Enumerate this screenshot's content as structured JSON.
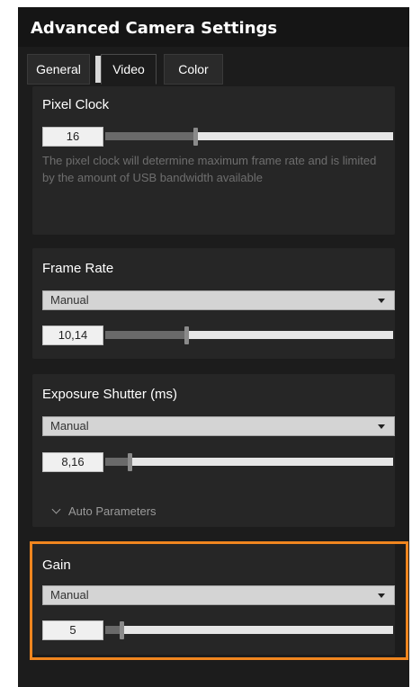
{
  "window": {
    "title": "Advanced Camera Settings"
  },
  "tabs": [
    {
      "label": "General",
      "active": false
    },
    {
      "label": "Video",
      "active": true
    },
    {
      "label": "Color",
      "active": false
    }
  ],
  "pixel_clock": {
    "title": "Pixel Clock",
    "value": "16",
    "slider_fraction": 0.31,
    "description": "The pixel clock will determine maximum frame rate and is limited by the amount of USB bandwidth available"
  },
  "frame_rate": {
    "title": "Frame Rate",
    "mode": "Manual",
    "value": "10,14",
    "slider_fraction": 0.28
  },
  "exposure": {
    "title": "Exposure Shutter (ms)",
    "mode": "Manual",
    "value": "8,16",
    "slider_fraction": 0.08,
    "auto_params_label": "Auto Parameters"
  },
  "gain": {
    "title": "Gain",
    "mode": "Manual",
    "value": "5",
    "slider_fraction": 0.05
  },
  "colors": {
    "highlight": "#f0861f",
    "panel_bg": "#1c1c1c",
    "group_bg": "#262626"
  }
}
